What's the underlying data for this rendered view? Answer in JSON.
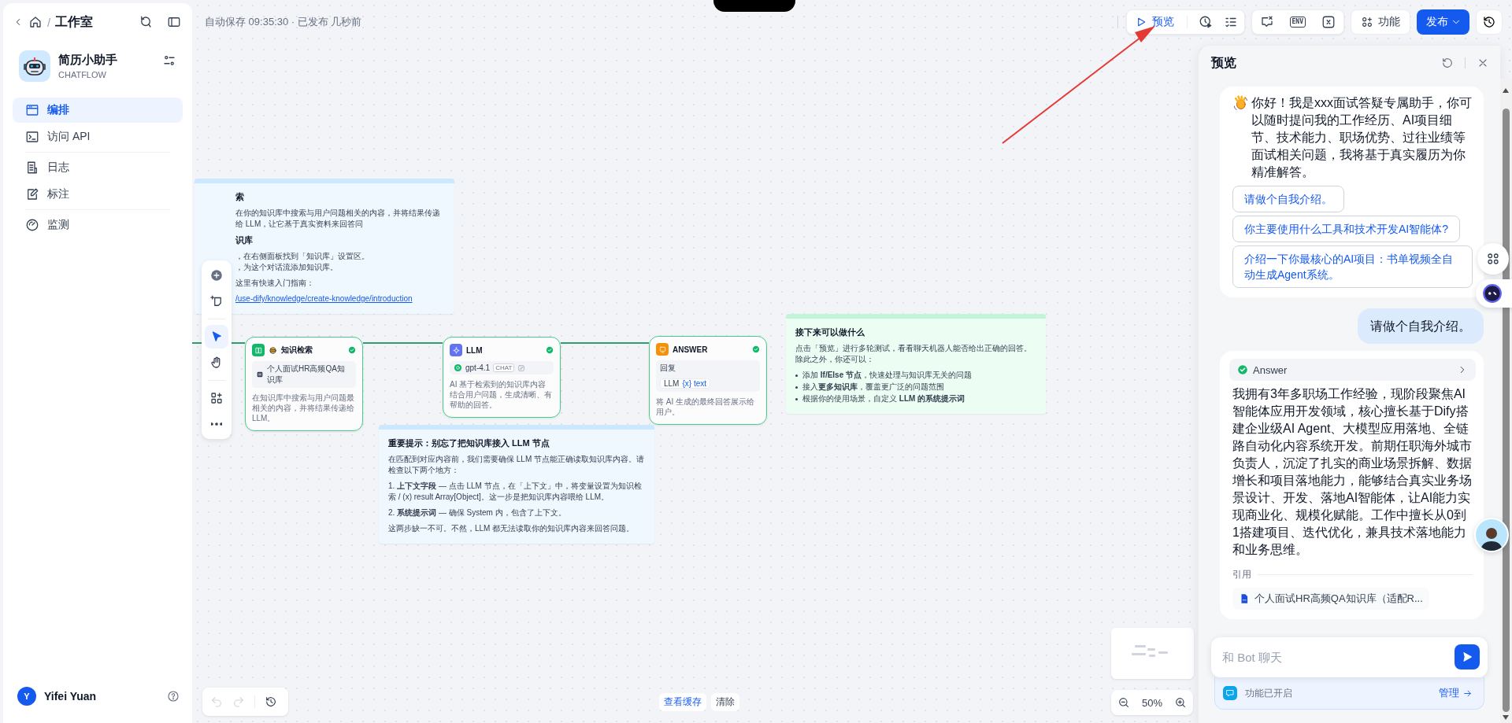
{
  "sidebar": {
    "breadcrumb": {
      "separator": "/",
      "current": "工作室"
    },
    "app": {
      "name": "简历小助手",
      "type": "CHATFLOW"
    },
    "nav": [
      {
        "items": [
          {
            "label": "编排",
            "selected": true
          },
          {
            "label": "访问 API",
            "selected": false
          }
        ]
      },
      {
        "items": [
          {
            "label": "日志",
            "selected": false
          },
          {
            "label": "标注",
            "selected": false
          }
        ]
      },
      {
        "items": [
          {
            "label": "监测",
            "selected": false
          }
        ]
      }
    ],
    "user": {
      "initial": "Y",
      "name": "Yifei Yuan"
    }
  },
  "header": {
    "status": "自动保存 09:35:30 · 已发布 几秒前",
    "preview_button": "预览",
    "env_label": "ENV",
    "features_button": "功能",
    "publish_button": "发布"
  },
  "canvas": {
    "notes": [
      {
        "color": "#eff8ff",
        "blocks": [
          {
            "kind": "heading",
            "text": "索"
          },
          {
            "kind": "text",
            "text": "在你的知识库中搜索与用户问题相关的内容，并将结果传递给 LLM，让它基于真实资料来回答问"
          },
          {
            "kind": "heading",
            "text": "识库"
          },
          {
            "kind": "lines",
            "items": [
              "，在右侧面板找到「知识库」设置区。",
              "，为这个对话流添加知识库。"
            ]
          },
          {
            "kind": "text",
            "text": "这里有快速入门指南："
          },
          {
            "kind": "link",
            "text": "/use-dify/knowledge/create-knowledge/introduction"
          }
        ]
      },
      {
        "color": "#eff8ff",
        "blocks": [
          {
            "kind": "heading",
            "text": "重要提示：别忘了把知识库接入 LLM 节点"
          },
          {
            "kind": "text",
            "text": "在匹配到对应内容前，我们需要确保 LLM 节点能正确读取知识库内容。请检查以下两个地方："
          },
          {
            "kind": "text",
            "text": "1. **上下文字段** — 点击 LLM 节点，在「上下文」中，将变量设置为知识检索 / (x) result Array[Object]。这一步是把知识库内容喂给 LLM。"
          },
          {
            "kind": "text",
            "text": "2. **系统提示词** — 确保 System 内，包含了上下文。"
          },
          {
            "kind": "text",
            "text": "这两步缺一不可。不然，LLM 都无法读取你的知识库内容来回答问题。"
          }
        ]
      },
      {
        "color": "#ecfdf3",
        "blocks": [
          {
            "kind": "heading",
            "text": "接下来可以做什么"
          },
          {
            "kind": "text",
            "text": "点击「预览」进行多轮测试，看看聊天机器人能否给出正确的回答。除此之外，你还可以："
          },
          {
            "kind": "bullets",
            "items": [
              "添加 **If/Else 节点**，快速处理与知识库无关的问题",
              "接入**更多知识库**，覆盖更广泛的问题范围",
              "根据你的使用场景，自定义 **LLM 的系统提示词**"
            ]
          }
        ]
      }
    ],
    "nodes": [
      {
        "kind": "knowledge",
        "title": "知识检索",
        "field": "个人面试HR高频QA知识库",
        "description": "在知识库中搜索与用户问题最相关的内容，并将结果传递给 LLM。"
      },
      {
        "kind": "llm",
        "title": "LLM",
        "model": "gpt-4.1",
        "badge": "CHAT",
        "description": "AI 基于检索到的知识库内容结合用户问题，生成清晰、有帮助的回答。"
      },
      {
        "kind": "answer",
        "title": "ANSWER",
        "field_label": "回复",
        "variable_source": "LLM",
        "variable": "{x} text",
        "description": "将 AI 生成的最终回答展示给用户。"
      }
    ],
    "modes": [
      {
        "selected": true
      },
      {
        "selected": false
      }
    ],
    "undo": {
      "disabled": true
    },
    "redo": {
      "disabled": true
    },
    "cache_button": "查看缓存",
    "clear_button": "清除",
    "zoom": "50%"
  },
  "preview": {
    "title": "预览",
    "messages": [
      {
        "kind": "bot",
        "text": "你好！我是xxx面试答疑专属助手，你可以随时提问我的工作经历、AI项目细节、技术能力、职场优势、过往业绩等面试相关问题，我将基于真实履历为你精准解答。",
        "suggestions": [
          "请做个自我介绍。",
          "你主要使用什么工具和技术开发AI智能体?",
          "介绍一下你最核心的AI项目：书单视频全自动生成Agent系统。"
        ]
      },
      {
        "kind": "user",
        "text": "请做个自我介绍。"
      },
      {
        "kind": "bot",
        "workflow": "Answer",
        "text": "我拥有3年多职场工作经验，现阶段聚焦AI智能体应用开发领域，核心擅长基于Dify搭建企业级AI Agent、大模型应用落地、全链路自动化内容系统开发。前期任职海外城市负责人，沉淀了扎实的商业场景拆解、数据增长和项目落地能力，能够结合真实业务场景设计、开发、落地AI智能体，让AI能力实现商业化、规模化赋能。工作中擅长从0到1搭建项目、迭代优化，兼具技术落地能力和业务思维。",
        "citation_label": "引用",
        "citations": [
          "个人面试HR高频QA知识库（适配R..."
        ]
      }
    ],
    "input": {
      "placeholder": "和 Bot 聊天"
    },
    "features": {
      "label": "功能已开启",
      "action": "管理"
    }
  }
}
